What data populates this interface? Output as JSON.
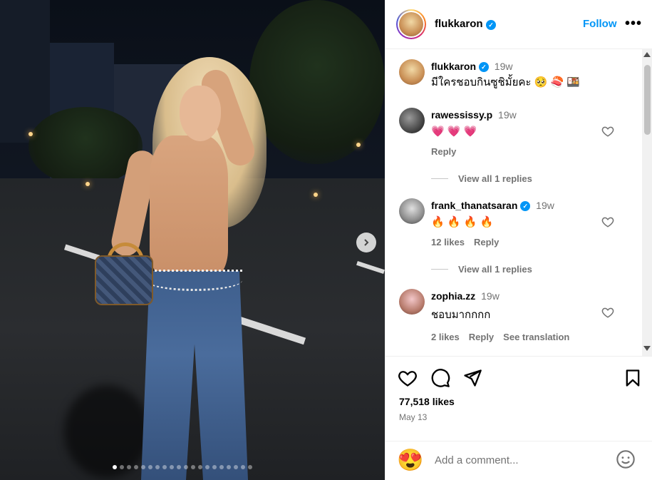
{
  "post": {
    "carousel": {
      "next_icon": "chevron-right-icon",
      "slide_count": 20,
      "active_index": 0
    }
  },
  "header": {
    "username": "flukkaron",
    "follow_label": "Follow",
    "more_icon": "•••"
  },
  "caption": {
    "username": "flukkaron",
    "time": "19w",
    "text": "มีใครชอบกินซูชิมั้ยคะ 🥺 🍣 🍱"
  },
  "comments": [
    {
      "username": "rawessissy.p",
      "time": "19w",
      "text": "💗 💗 💗",
      "likes": "",
      "reply_label": "Reply",
      "verified": false
    },
    {
      "username": "frank_thanatsaran",
      "time": "19w",
      "text": "🔥 🔥 🔥 🔥",
      "likes": "12 likes",
      "reply_label": "Reply",
      "verified": true
    },
    {
      "username": "zophia.zz",
      "time": "19w",
      "text": "ชอบมากกกก",
      "likes": "2 likes",
      "reply_label": "Reply",
      "translate_label": "See translation",
      "verified": false
    }
  ],
  "view_replies": [
    "View all 1 replies",
    "View all 1 replies"
  ],
  "footer": {
    "likes": "77,518 likes",
    "date": "May 13",
    "add_comment_placeholder": "Add a comment...",
    "emoji": "😍"
  },
  "colors": {
    "accent": "#0095f6",
    "muted": "#737373",
    "border": "#efefef"
  }
}
